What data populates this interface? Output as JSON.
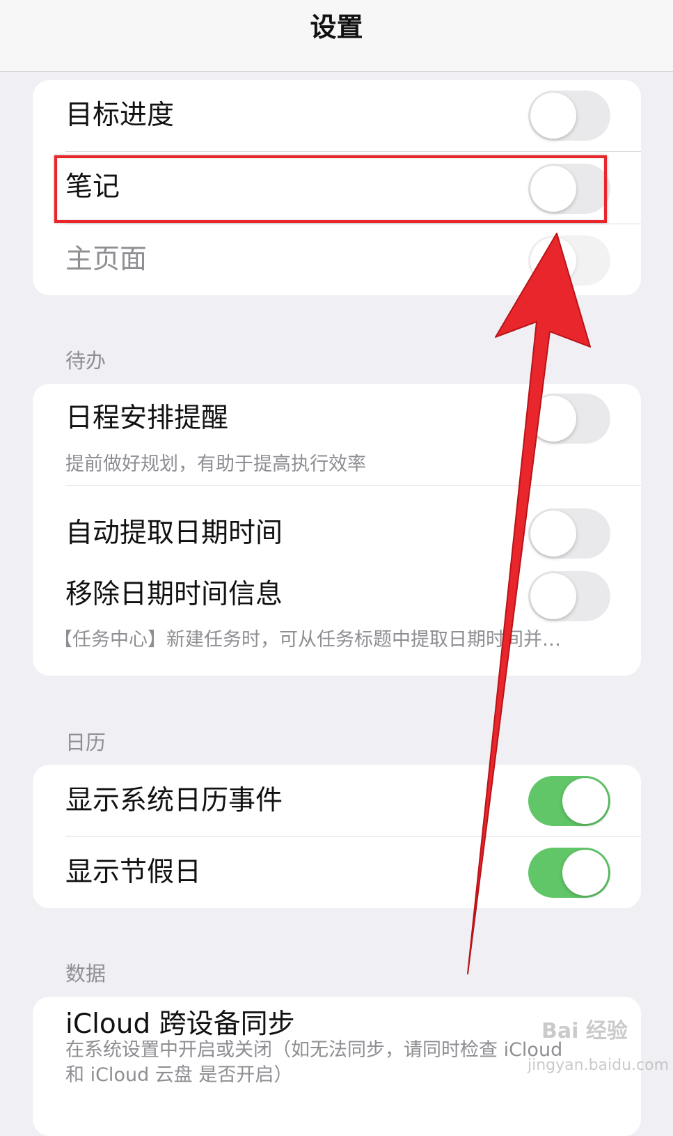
{
  "navbar": {
    "title": "设置"
  },
  "group1": {
    "rows": [
      {
        "label": "目标进度",
        "on": false
      },
      {
        "label": "笔记",
        "on": false
      },
      {
        "label": "主页面",
        "on": false
      }
    ]
  },
  "todo": {
    "header": "待办",
    "schedule_reminder": {
      "label": "日程安排提醒",
      "desc": "提前做好规划，有助于提高执行效率",
      "on": false
    },
    "auto_extract": {
      "label": "自动提取日期时间",
      "on": false
    },
    "remove_datetime": {
      "label": "移除日期时间信息",
      "on": false
    },
    "footer_desc": "【任务中心】新建任务时，可从任务标题中提取日期时间并…"
  },
  "calendar": {
    "header": "日历",
    "show_system_events": {
      "label": "显示系统日历事件",
      "on": true
    },
    "show_holidays": {
      "label": "显示节假日",
      "on": true
    }
  },
  "data": {
    "header": "数据",
    "icloud_sync": {
      "label": "iCloud 跨设备同步",
      "desc_line1": "在系统设置中开启或关闭（如无法同步，请同时检查 iCloud",
      "desc_line2": "和 iCloud 云盘 是否开启）"
    }
  },
  "watermark": {
    "logo_text": "Bai 经验",
    "url": "jingyan.baidu.com"
  },
  "colors": {
    "toggle_on": "#61c668",
    "toggle_off": "#e9e9eb",
    "annotation_red": "#e8262b",
    "background": "#efeff4"
  }
}
